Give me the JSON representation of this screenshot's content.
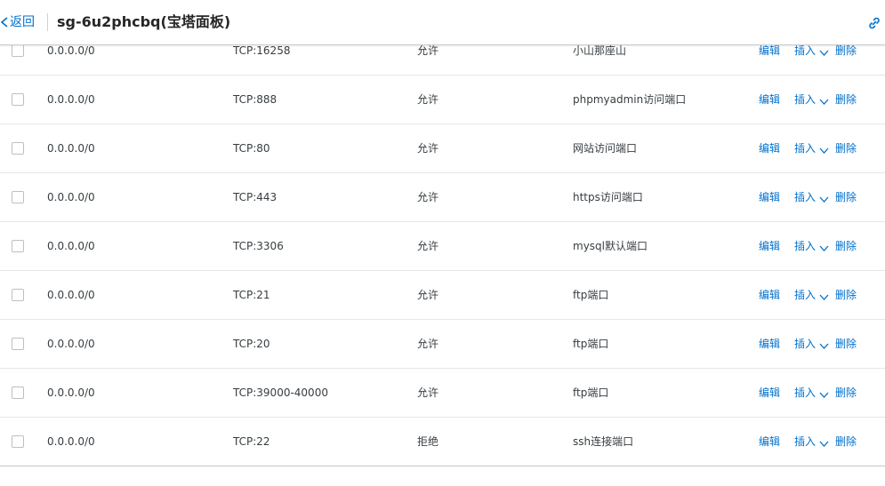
{
  "header": {
    "back_label": "返回",
    "title": "sg-6u2phcbq(宝塔面板)"
  },
  "colors": {
    "link": "#0070cc",
    "text": "#373d41",
    "border": "#e6e6e6"
  },
  "icons": {
    "back": "chevron-left-icon",
    "link": "link-icon",
    "insert_dropdown": "chevron-down-icon"
  },
  "actions": {
    "edit": "编辑",
    "insert": "插入",
    "delete": "删除"
  },
  "rules": [
    {
      "source": "0.0.0.0/0",
      "port": "TCP:16258",
      "policy": "允许",
      "description": "小山那座山"
    },
    {
      "source": "0.0.0.0/0",
      "port": "TCP:888",
      "policy": "允许",
      "description": "phpmyadmin访问端口"
    },
    {
      "source": "0.0.0.0/0",
      "port": "TCP:80",
      "policy": "允许",
      "description": "网站访问端口"
    },
    {
      "source": "0.0.0.0/0",
      "port": "TCP:443",
      "policy": "允许",
      "description": "https访问端口"
    },
    {
      "source": "0.0.0.0/0",
      "port": "TCP:3306",
      "policy": "允许",
      "description": "mysql默认端口"
    },
    {
      "source": "0.0.0.0/0",
      "port": "TCP:21",
      "policy": "允许",
      "description": "ftp端口"
    },
    {
      "source": "0.0.0.0/0",
      "port": "TCP:20",
      "policy": "允许",
      "description": "ftp端口"
    },
    {
      "source": "0.0.0.0/0",
      "port": "TCP:39000-40000",
      "policy": "允许",
      "description": "ftp端口"
    },
    {
      "source": "0.0.0.0/0",
      "port": "TCP:22",
      "policy": "拒绝",
      "description": "ssh连接端口"
    }
  ]
}
